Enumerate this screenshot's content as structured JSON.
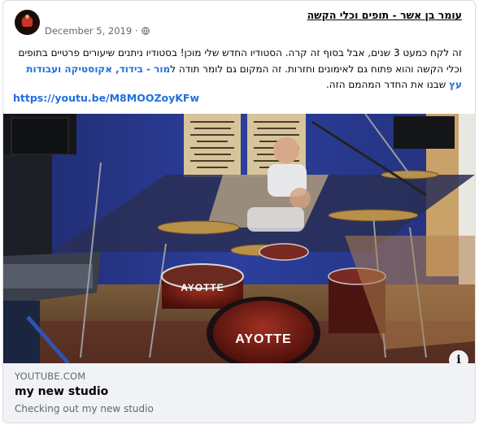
{
  "post": {
    "author": "עומר בן אשר - תופים וכלי הקשה",
    "date": "December 5, 2019 ·",
    "privacy_icon": "globe-icon",
    "text_plain": "זה לקח כמעט 3 שנים, אבל בסוף זה קרה. הסטודיו החדש שלי מוכן! בסטודיו ניתנים שיעורים פרטיים בתופים וכלי הקשה והוא פתוח גם לאימונים וחזרות. זה המקום גם לומר תודה ל",
    "text_tag": "מור - בידוד, אקוסטיקה ועבודות עץ",
    "text_tail": " שבנו את החדר המהמם הזה.",
    "link": "https://youtu.be/M8MOOZoyKFw"
  },
  "preview": {
    "domain": "YOUTUBE.COM",
    "title": "my new studio",
    "description": "Checking out my new studio",
    "drum_logo": "AYOTTE",
    "info_icon": "i"
  }
}
